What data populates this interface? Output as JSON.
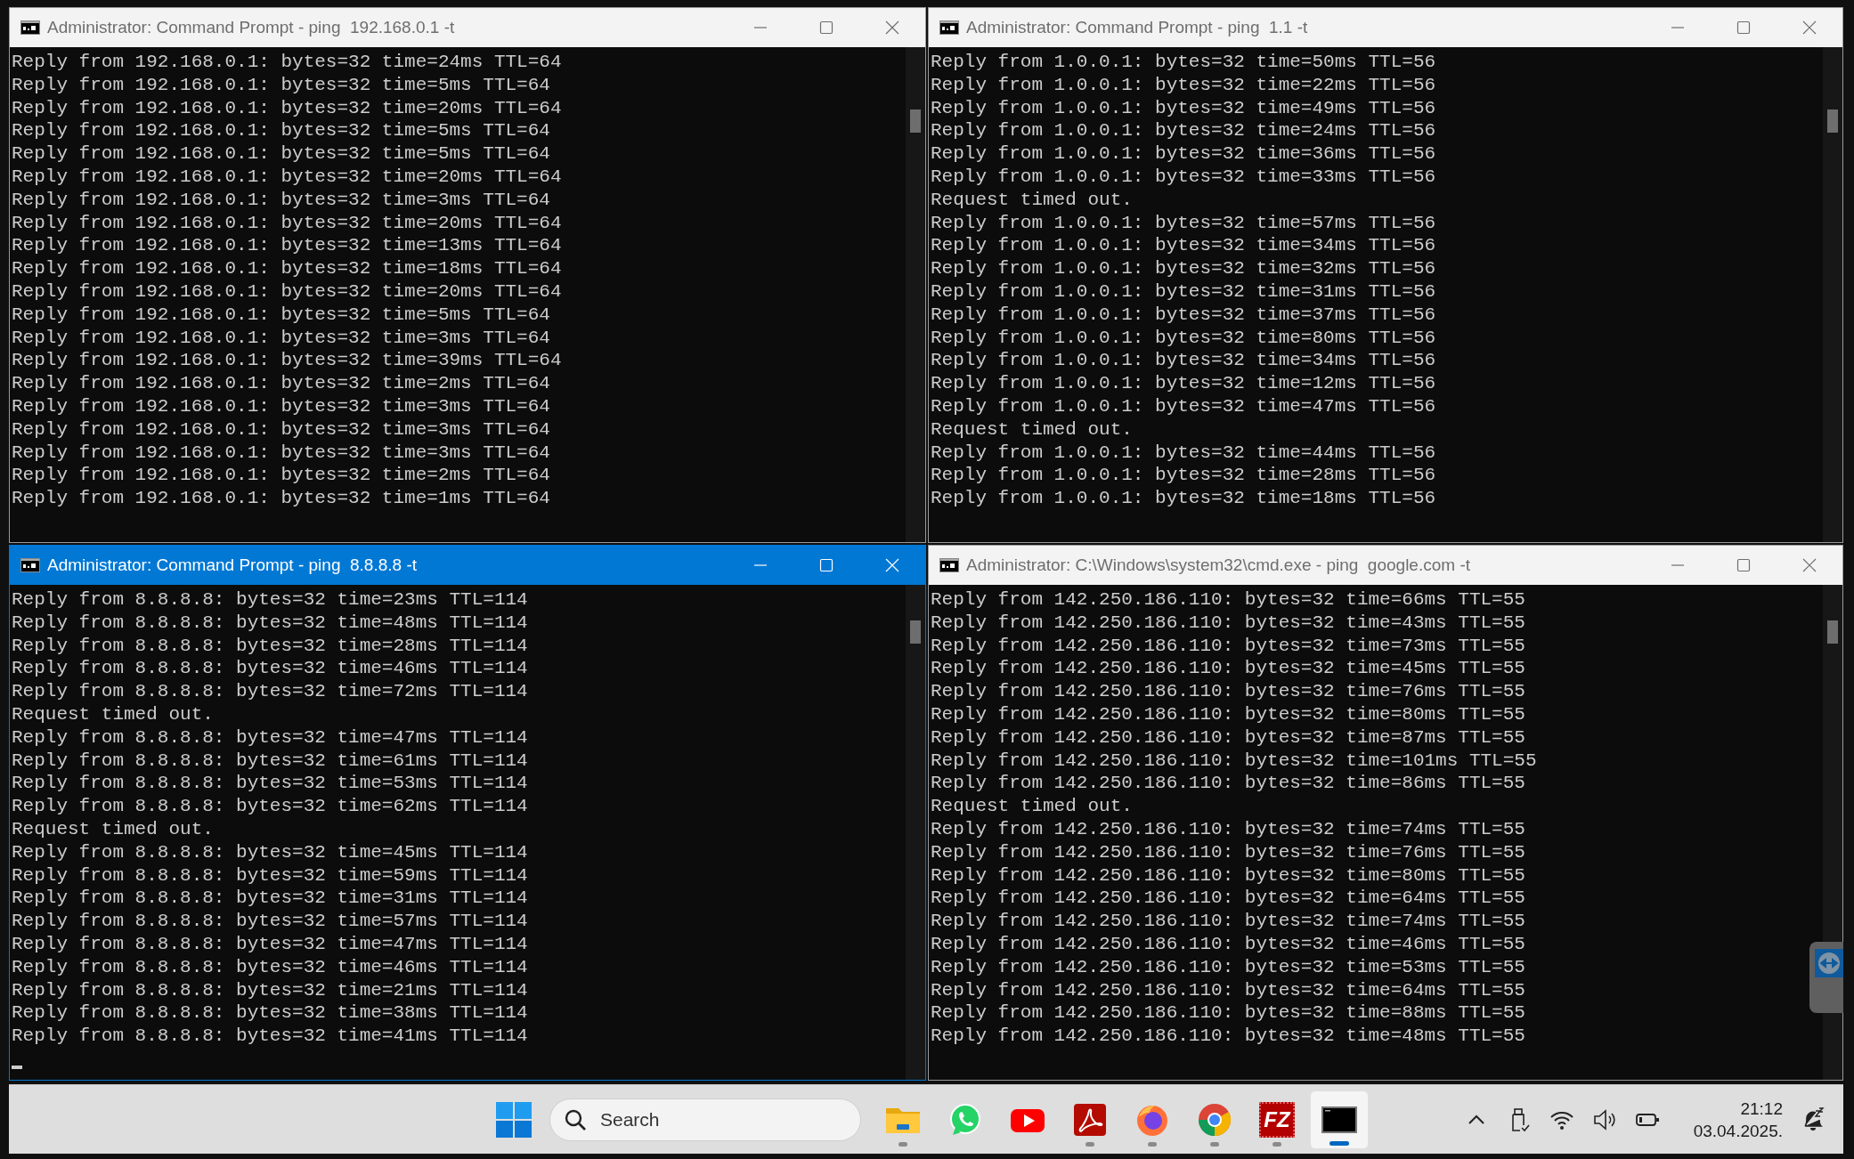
{
  "windows": [
    {
      "title": "Administrator: Command Prompt - ping  192.168.0.1 -t",
      "active": false,
      "cursor": false,
      "lines": [
        "Reply from 192.168.0.1: bytes=32 time=24ms TTL=64",
        "Reply from 192.168.0.1: bytes=32 time=5ms TTL=64",
        "Reply from 192.168.0.1: bytes=32 time=20ms TTL=64",
        "Reply from 192.168.0.1: bytes=32 time=5ms TTL=64",
        "Reply from 192.168.0.1: bytes=32 time=5ms TTL=64",
        "Reply from 192.168.0.1: bytes=32 time=20ms TTL=64",
        "Reply from 192.168.0.1: bytes=32 time=3ms TTL=64",
        "Reply from 192.168.0.1: bytes=32 time=20ms TTL=64",
        "Reply from 192.168.0.1: bytes=32 time=13ms TTL=64",
        "Reply from 192.168.0.1: bytes=32 time=18ms TTL=64",
        "Reply from 192.168.0.1: bytes=32 time=20ms TTL=64",
        "Reply from 192.168.0.1: bytes=32 time=5ms TTL=64",
        "Reply from 192.168.0.1: bytes=32 time=3ms TTL=64",
        "Reply from 192.168.0.1: bytes=32 time=39ms TTL=64",
        "Reply from 192.168.0.1: bytes=32 time=2ms TTL=64",
        "Reply from 192.168.0.1: bytes=32 time=3ms TTL=64",
        "Reply from 192.168.0.1: bytes=32 time=3ms TTL=64",
        "Reply from 192.168.0.1: bytes=32 time=3ms TTL=64",
        "Reply from 192.168.0.1: bytes=32 time=2ms TTL=64",
        "Reply from 192.168.0.1: bytes=32 time=1ms TTL=64"
      ]
    },
    {
      "title": "Administrator: Command Prompt - ping  1.1 -t",
      "active": false,
      "cursor": false,
      "lines": [
        "Reply from 1.0.0.1: bytes=32 time=50ms TTL=56",
        "Reply from 1.0.0.1: bytes=32 time=22ms TTL=56",
        "Reply from 1.0.0.1: bytes=32 time=49ms TTL=56",
        "Reply from 1.0.0.1: bytes=32 time=24ms TTL=56",
        "Reply from 1.0.0.1: bytes=32 time=36ms TTL=56",
        "Reply from 1.0.0.1: bytes=32 time=33ms TTL=56",
        "Request timed out.",
        "Reply from 1.0.0.1: bytes=32 time=57ms TTL=56",
        "Reply from 1.0.0.1: bytes=32 time=34ms TTL=56",
        "Reply from 1.0.0.1: bytes=32 time=32ms TTL=56",
        "Reply from 1.0.0.1: bytes=32 time=31ms TTL=56",
        "Reply from 1.0.0.1: bytes=32 time=37ms TTL=56",
        "Reply from 1.0.0.1: bytes=32 time=80ms TTL=56",
        "Reply from 1.0.0.1: bytes=32 time=34ms TTL=56",
        "Reply from 1.0.0.1: bytes=32 time=12ms TTL=56",
        "Reply from 1.0.0.1: bytes=32 time=47ms TTL=56",
        "Request timed out.",
        "Reply from 1.0.0.1: bytes=32 time=44ms TTL=56",
        "Reply from 1.0.0.1: bytes=32 time=28ms TTL=56",
        "Reply from 1.0.0.1: bytes=32 time=18ms TTL=56"
      ]
    },
    {
      "title": "Administrator: Command Prompt - ping  8.8.8.8 -t",
      "active": true,
      "cursor": true,
      "lines": [
        "Reply from 8.8.8.8: bytes=32 time=23ms TTL=114",
        "Reply from 8.8.8.8: bytes=32 time=48ms TTL=114",
        "Reply from 8.8.8.8: bytes=32 time=28ms TTL=114",
        "Reply from 8.8.8.8: bytes=32 time=46ms TTL=114",
        "Reply from 8.8.8.8: bytes=32 time=72ms TTL=114",
        "Request timed out.",
        "Reply from 8.8.8.8: bytes=32 time=47ms TTL=114",
        "Reply from 8.8.8.8: bytes=32 time=61ms TTL=114",
        "Reply from 8.8.8.8: bytes=32 time=53ms TTL=114",
        "Reply from 8.8.8.8: bytes=32 time=62ms TTL=114",
        "Request timed out.",
        "Reply from 8.8.8.8: bytes=32 time=45ms TTL=114",
        "Reply from 8.8.8.8: bytes=32 time=59ms TTL=114",
        "Reply from 8.8.8.8: bytes=32 time=31ms TTL=114",
        "Reply from 8.8.8.8: bytes=32 time=57ms TTL=114",
        "Reply from 8.8.8.8: bytes=32 time=47ms TTL=114",
        "Reply from 8.8.8.8: bytes=32 time=46ms TTL=114",
        "Reply from 8.8.8.8: bytes=32 time=21ms TTL=114",
        "Reply from 8.8.8.8: bytes=32 time=38ms TTL=114",
        "Reply from 8.8.8.8: bytes=32 time=41ms TTL=114"
      ]
    },
    {
      "title": "Administrator: C:\\Windows\\system32\\cmd.exe - ping  google.com -t",
      "active": false,
      "cursor": false,
      "lines": [
        "Reply from 142.250.186.110: bytes=32 time=66ms TTL=55",
        "Reply from 142.250.186.110: bytes=32 time=43ms TTL=55",
        "Reply from 142.250.186.110: bytes=32 time=73ms TTL=55",
        "Reply from 142.250.186.110: bytes=32 time=45ms TTL=55",
        "Reply from 142.250.186.110: bytes=32 time=76ms TTL=55",
        "Reply from 142.250.186.110: bytes=32 time=80ms TTL=55",
        "Reply from 142.250.186.110: bytes=32 time=87ms TTL=55",
        "Reply from 142.250.186.110: bytes=32 time=101ms TTL=55",
        "Reply from 142.250.186.110: bytes=32 time=86ms TTL=55",
        "Request timed out.",
        "Reply from 142.250.186.110: bytes=32 time=74ms TTL=55",
        "Reply from 142.250.186.110: bytes=32 time=76ms TTL=55",
        "Reply from 142.250.186.110: bytes=32 time=80ms TTL=55",
        "Reply from 142.250.186.110: bytes=32 time=64ms TTL=55",
        "Reply from 142.250.186.110: bytes=32 time=74ms TTL=55",
        "Reply from 142.250.186.110: bytes=32 time=46ms TTL=55",
        "Reply from 142.250.186.110: bytes=32 time=53ms TTL=55",
        "Reply from 142.250.186.110: bytes=32 time=64ms TTL=55",
        "Reply from 142.250.186.110: bytes=32 time=88ms TTL=55",
        "Reply from 142.250.186.110: bytes=32 time=48ms TTL=55"
      ]
    }
  ],
  "taskbar": {
    "search": {
      "placeholder": "Search"
    },
    "apps": [
      {
        "kind": "folder",
        "running": true,
        "selected": false
      },
      {
        "kind": "whatsapp",
        "running": false,
        "selected": false
      },
      {
        "kind": "youtube",
        "running": false,
        "selected": false
      },
      {
        "kind": "acrobat",
        "running": true,
        "selected": false
      },
      {
        "kind": "firefox",
        "running": true,
        "selected": false
      },
      {
        "kind": "chrome",
        "running": true,
        "selected": false
      },
      {
        "kind": "filezilla",
        "logo_text": "FZ",
        "running": true,
        "selected": false
      },
      {
        "kind": "terminal",
        "running": true,
        "selected": true
      }
    ],
    "clock": {
      "time": "21:12",
      "date": "03.04.2025."
    }
  }
}
